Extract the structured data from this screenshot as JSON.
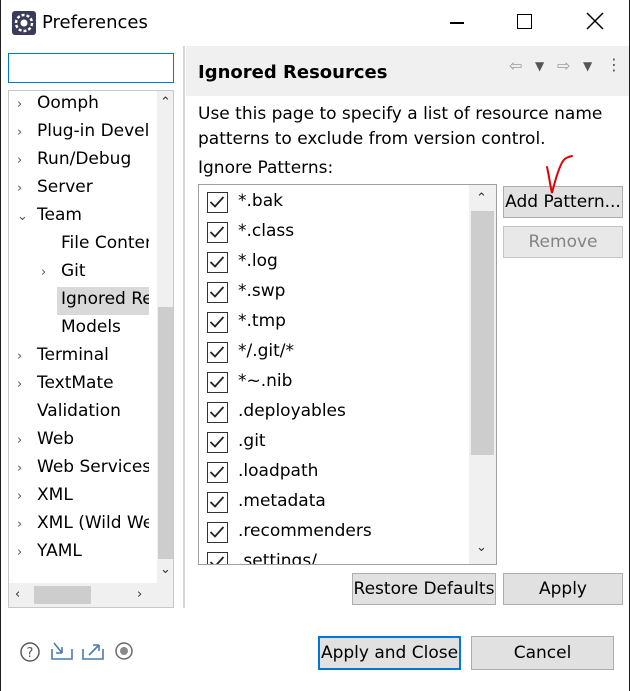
{
  "window": {
    "title": "Preferences"
  },
  "filter": {
    "value": "",
    "placeholder": ""
  },
  "tree": {
    "items": [
      {
        "label": "Oomph",
        "expander": "›",
        "level": 0
      },
      {
        "label": "Plug-in Development",
        "expander": "›",
        "level": 0
      },
      {
        "label": "Run/Debug",
        "expander": "›",
        "level": 0
      },
      {
        "label": "Server",
        "expander": "›",
        "level": 0
      },
      {
        "label": "Team",
        "expander": "⌄",
        "level": 0
      },
      {
        "label": "File Content",
        "expander": "",
        "level": 1
      },
      {
        "label": "Git",
        "expander": "›",
        "level": 1
      },
      {
        "label": "Ignored Resources",
        "expander": "",
        "level": 1,
        "selected": true
      },
      {
        "label": "Models",
        "expander": "",
        "level": 1
      },
      {
        "label": "Terminal",
        "expander": "›",
        "level": 0
      },
      {
        "label": "TextMate",
        "expander": "›",
        "level": 0
      },
      {
        "label": "Validation",
        "expander": "",
        "level": 0
      },
      {
        "label": "Web",
        "expander": "›",
        "level": 0
      },
      {
        "label": "Web Services",
        "expander": "›",
        "level": 0
      },
      {
        "label": "XML",
        "expander": "›",
        "level": 0
      },
      {
        "label": "XML (Wild Web Developer)",
        "expander": "›",
        "level": 0
      },
      {
        "label": "YAML",
        "expander": "›",
        "level": 0
      }
    ]
  },
  "page": {
    "title": "Ignored Resources",
    "description": "Use this page to specify a list of resource name patterns to exclude from version control.",
    "patterns_label": "Ignore Patterns:",
    "patterns": [
      {
        "text": "*.bak",
        "checked": true
      },
      {
        "text": "*.class",
        "checked": true
      },
      {
        "text": "*.log",
        "checked": true
      },
      {
        "text": "*.swp",
        "checked": true
      },
      {
        "text": "*.tmp",
        "checked": true
      },
      {
        "text": "*/.git/*",
        "checked": true
      },
      {
        "text": "*~.nib",
        "checked": true
      },
      {
        "text": ".deployables",
        "checked": true
      },
      {
        "text": ".git",
        "checked": true
      },
      {
        "text": ".loadpath",
        "checked": true
      },
      {
        "text": ".metadata",
        "checked": true
      },
      {
        "text": ".recommenders",
        "checked": true
      },
      {
        "text": ".settings/",
        "checked": true
      }
    ]
  },
  "buttons": {
    "add_pattern": "Add Pattern...",
    "remove": "Remove",
    "restore_defaults": "Restore Defaults",
    "apply": "Apply",
    "apply_and_close": "Apply and Close",
    "cancel": "Cancel"
  },
  "icons": {
    "nav": [
      "back-arrow-icon",
      "dropdown-icon",
      "forward-arrow-icon",
      "dropdown-icon",
      "more-icon"
    ],
    "bottom": [
      "help-icon",
      "import-icon",
      "export-icon",
      "record-icon"
    ]
  },
  "colors": {
    "accent": "#0078d7",
    "annotation": "#e00000",
    "selection": "#d9d9d9"
  }
}
